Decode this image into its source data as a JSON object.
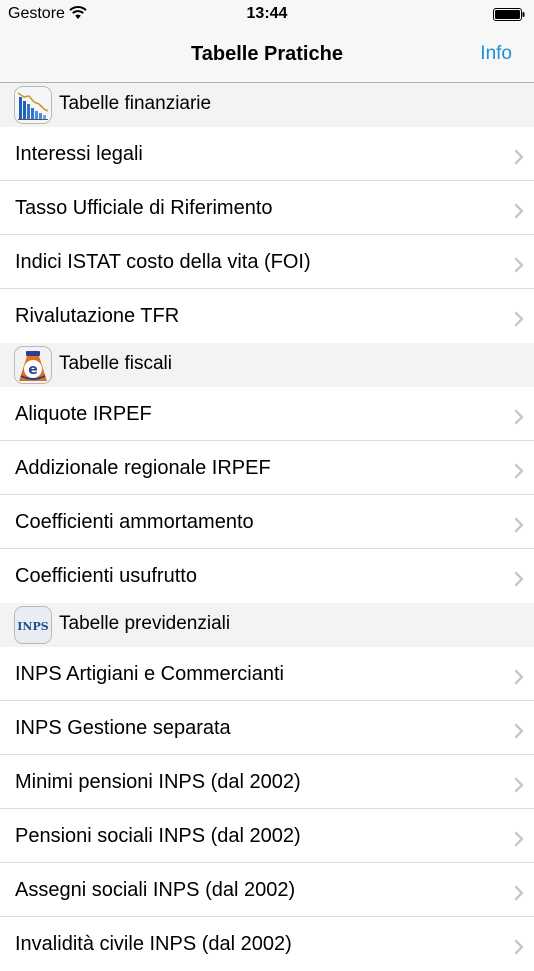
{
  "status_bar": {
    "carrier": "Gestore",
    "time": "13:44"
  },
  "nav": {
    "title": "Tabelle Pratiche",
    "info_label": "Info"
  },
  "sections": [
    {
      "title": "Tabelle finanziarie",
      "icon": "financial-chart-icon",
      "items": [
        "Interessi legali",
        "Tasso Ufficiale di Riferimento",
        "Indici ISTAT costo della vita (FOI)",
        "Rivalutazione TFR"
      ]
    },
    {
      "title": "Tabelle fiscali",
      "icon": "tax-agency-icon",
      "items": [
        "Aliquote IRPEF",
        "Addizionale regionale IRPEF",
        "Coefficienti ammortamento",
        "Coefficienti usufrutto"
      ]
    },
    {
      "title": "Tabelle previdenziali",
      "icon": "inps-logo-icon",
      "icon_text": "INPS",
      "items": [
        "INPS Artigiani e Commercianti",
        "INPS Gestione separata",
        "Minimi pensioni INPS (dal 2002)",
        "Pensioni sociali INPS (dal 2002)",
        "Assegni sociali INPS (dal 2002)",
        "Invalidità civile INPS (dal 2002)"
      ]
    }
  ],
  "colors": {
    "accent": "#1e8fd6",
    "nav_background": "#f7f7f7",
    "section_background": "#f3f3f3",
    "separator": "#dcdcdc",
    "chevron": "#c7c7cc"
  }
}
